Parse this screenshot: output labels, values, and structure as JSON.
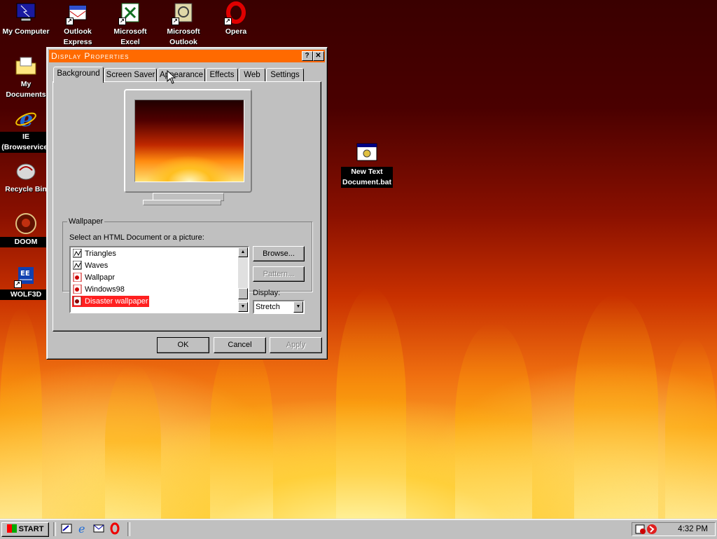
{
  "desktop": {
    "icons": [
      {
        "label": "My Computer",
        "icon": "computer-icon"
      },
      {
        "label": "Outlook Express",
        "icon": "outlook-express-icon"
      },
      {
        "label": "Microsoft Excel",
        "icon": "excel-icon"
      },
      {
        "label": "Microsoft Outlook",
        "icon": "outlook-icon"
      },
      {
        "label": "Opera",
        "icon": "opera-icon"
      },
      {
        "label": "My Documents",
        "icon": "folder-icon"
      },
      {
        "label": "IE (Browservice)",
        "icon": "ie-icon"
      },
      {
        "label": "Recycle Bin",
        "icon": "recycle-bin-icon"
      },
      {
        "label": "DOOM",
        "icon": "doom-icon"
      },
      {
        "label": "WOLF3D",
        "icon": "wolf3d-icon"
      },
      {
        "label": "New Text Document.bat",
        "icon": "batch-file-icon"
      }
    ]
  },
  "dialog": {
    "title": "Display Properties",
    "help_btn": "?",
    "close_btn": "✕",
    "tabs": [
      {
        "label": "Background"
      },
      {
        "label": "Screen Saver"
      },
      {
        "label": "Appearance"
      },
      {
        "label": "Effects"
      },
      {
        "label": "Web"
      },
      {
        "label": "Settings"
      }
    ],
    "active_tab": "Background",
    "wallpaper": {
      "group_label": "Wallpaper",
      "select_label": "Select an HTML Document or a picture:",
      "items": [
        {
          "label": "Triangles",
          "icon": "bitmap-icon"
        },
        {
          "label": "Waves",
          "icon": "bitmap-icon"
        },
        {
          "label": "Wallpapr",
          "icon": "html-document-icon"
        },
        {
          "label": "Windows98",
          "icon": "html-document-icon"
        },
        {
          "label": "Disaster wallpaper",
          "icon": "html-document-icon"
        }
      ],
      "selected": "Disaster wallpaper",
      "browse_label": "Browse...",
      "pattern_label": "Pattern...",
      "display_label": "Display:",
      "display_value": "Stretch"
    },
    "ok_label": "OK",
    "cancel_label": "Cancel",
    "apply_label": "Apply"
  },
  "taskbar": {
    "start_label": "Start",
    "quick_launch": [
      "show-desktop-icon",
      "ie-icon",
      "outlook-express-icon",
      "opera-icon"
    ],
    "clock": "4:32 PM"
  },
  "colors": {
    "title_bar": "#ff6a00",
    "selection": "#ff2020",
    "window_face": "#c0c0c0"
  }
}
